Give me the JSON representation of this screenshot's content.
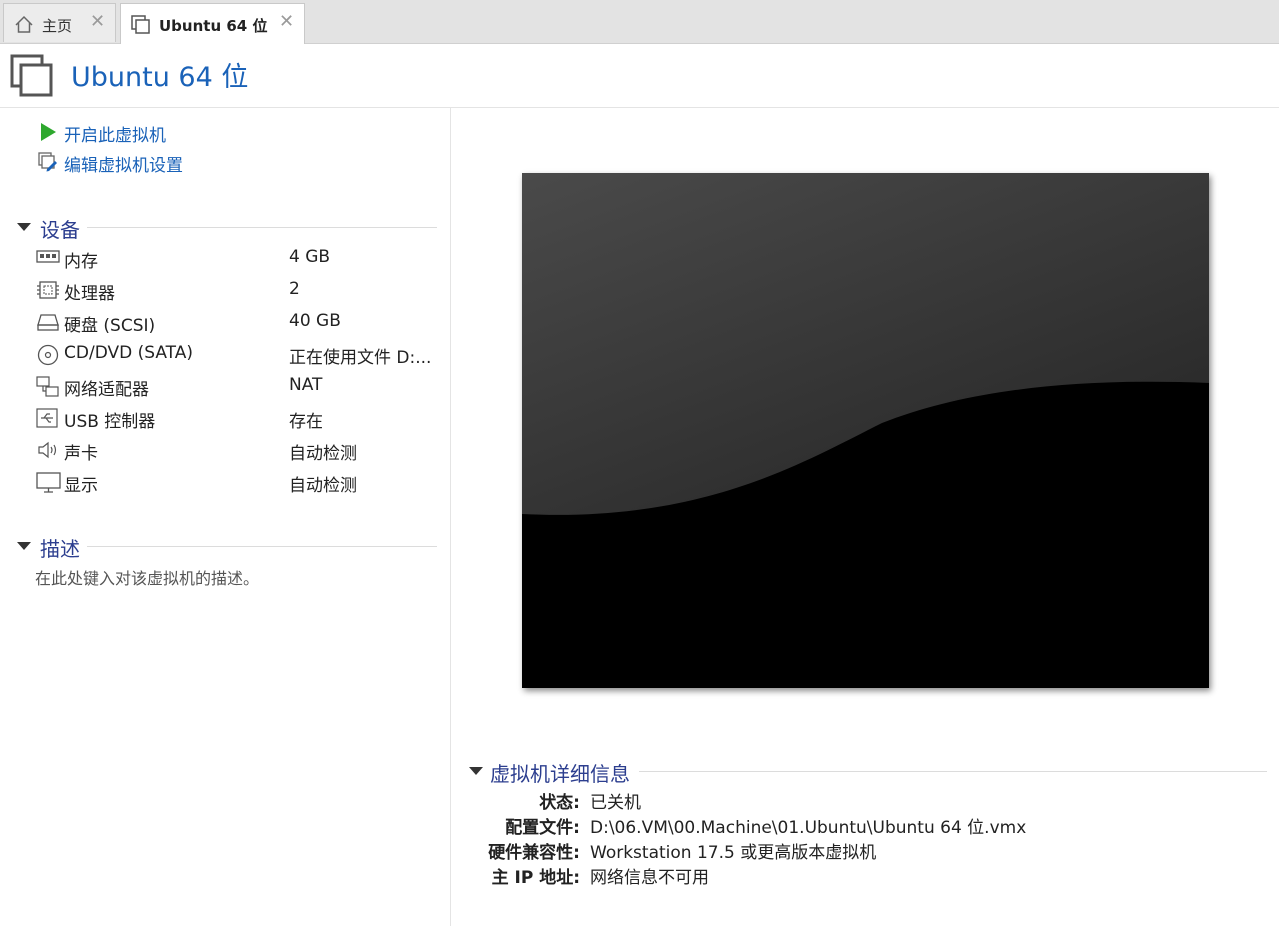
{
  "tabs": [
    {
      "label": "主页",
      "icon": "home-icon"
    },
    {
      "label": "Ubuntu 64 位",
      "icon": "vm-icon",
      "active": true
    }
  ],
  "header": {
    "title": "Ubuntu 64 位",
    "icon": "vm-large-icon"
  },
  "actions": {
    "power_on": "开启此虚拟机",
    "edit_settings": "编辑虚拟机设置"
  },
  "devices": {
    "title": "设备",
    "items": [
      {
        "name": "内存",
        "value": "4 GB",
        "icon": "memory-icon"
      },
      {
        "name": "处理器",
        "value": "2",
        "icon": "cpu-icon"
      },
      {
        "name": "硬盘 (SCSI)",
        "value": "40 GB",
        "icon": "harddisk-icon"
      },
      {
        "name": "CD/DVD (SATA)",
        "value": "正在使用文件 D:...",
        "icon": "cd-dvd-icon"
      },
      {
        "name": "网络适配器",
        "value": "NAT",
        "icon": "network-icon"
      },
      {
        "name": "USB 控制器",
        "value": "存在",
        "icon": "usb-icon"
      },
      {
        "name": "声卡",
        "value": "自动检测",
        "icon": "sound-icon"
      },
      {
        "name": "显示",
        "value": "自动检测",
        "icon": "display-icon"
      }
    ]
  },
  "description": {
    "title": "描述",
    "placeholder": "在此处键入对该虚拟机的描述。"
  },
  "details": {
    "title": "虚拟机详细信息",
    "rows": [
      {
        "key": "状态:",
        "value": "已关机"
      },
      {
        "key": "配置文件:",
        "value": "D:\\06.VM\\00.Machine\\01.Ubuntu\\Ubuntu 64 位.vmx"
      },
      {
        "key": "硬件兼容性:",
        "value": "Workstation 17.5 或更高版本虚拟机"
      },
      {
        "key": "主 IP 地址:",
        "value": "网络信息不可用"
      }
    ]
  },
  "colors": {
    "link": "#1a62b8",
    "section": "#2c3e8f",
    "play": "#2ea82e"
  }
}
